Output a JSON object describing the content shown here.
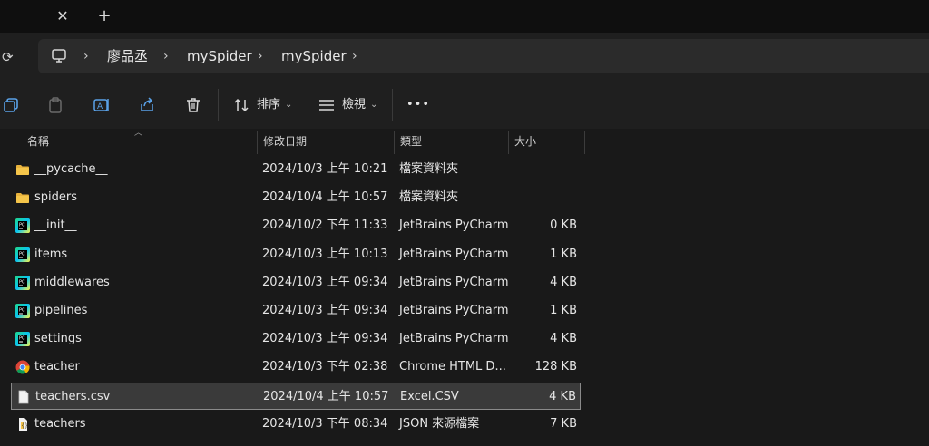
{
  "tabbar": {
    "close_glyph": "✕",
    "add_glyph": "+"
  },
  "address": {
    "refresh_glyph": "⟳",
    "separator": "›",
    "crumbs": [
      "廖品丞",
      "mySpider",
      "mySpider"
    ],
    "pc_icon": "computer-icon"
  },
  "toolbar": {
    "sort_label": "排序",
    "view_label": "檢視",
    "more_glyph": "•••",
    "chevron": "⌄"
  },
  "columns": {
    "name": "名稱",
    "modified": "修改日期",
    "type": "類型",
    "size": "大小"
  },
  "files": [
    {
      "icon": "folder-icon",
      "name": "__pycache__",
      "modified": "2024/10/3 上午 10:21",
      "type": "檔案資料夾",
      "size": ""
    },
    {
      "icon": "folder-icon",
      "name": "spiders",
      "modified": "2024/10/4 上午 10:57",
      "type": "檔案資料夾",
      "size": ""
    },
    {
      "icon": "pycharm-icon",
      "name": "__init__",
      "modified": "2024/10/2 下午 11:33",
      "type": "JetBrains PyCharm",
      "size": "0 KB"
    },
    {
      "icon": "pycharm-icon",
      "name": "items",
      "modified": "2024/10/3 上午 10:13",
      "type": "JetBrains PyCharm",
      "size": "1 KB"
    },
    {
      "icon": "pycharm-icon",
      "name": "middlewares",
      "modified": "2024/10/3 上午 09:34",
      "type": "JetBrains PyCharm",
      "size": "4 KB"
    },
    {
      "icon": "pycharm-icon",
      "name": "pipelines",
      "modified": "2024/10/3 上午 09:34",
      "type": "JetBrains PyCharm",
      "size": "1 KB"
    },
    {
      "icon": "pycharm-icon",
      "name": "settings",
      "modified": "2024/10/3 上午 09:34",
      "type": "JetBrains PyCharm",
      "size": "4 KB"
    },
    {
      "icon": "chrome-icon",
      "name": "teacher",
      "modified": "2024/10/3 下午 02:38",
      "type": "Chrome HTML D...",
      "size": "128 KB"
    },
    {
      "icon": "file-icon",
      "name": "teachers.csv",
      "modified": "2024/10/4 上午 10:57",
      "type": "Excel.CSV",
      "size": "4 KB",
      "selected": true
    },
    {
      "icon": "json-icon",
      "name": "teachers",
      "modified": "2024/10/3 下午 08:34",
      "type": "JSON 來源檔案",
      "size": "7 KB"
    }
  ],
  "colors": {
    "background": "#191919",
    "titlebar": "#0f0f0f",
    "toolbar": "#1f1f1f",
    "addressbar": "#2b2b2b",
    "selection": "#3a3a3a",
    "folder": "#e8b23c"
  }
}
